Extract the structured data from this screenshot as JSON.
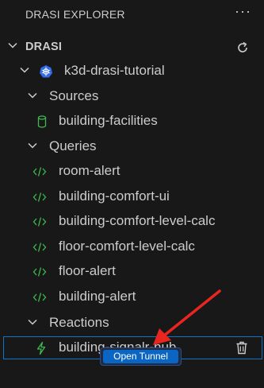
{
  "header": {
    "title": "DRASI EXPLORER",
    "more_icon": "ellipsis-icon"
  },
  "root": {
    "label": "DRASI",
    "refresh_icon": "refresh-icon"
  },
  "cluster": {
    "label": "k3d-drasi-tutorial",
    "icon": "kubernetes-icon"
  },
  "sources": {
    "label": "Sources",
    "items": [
      {
        "label": "building-facilities",
        "icon": "database-icon"
      }
    ]
  },
  "queries": {
    "label": "Queries",
    "items": [
      {
        "label": "room-alert"
      },
      {
        "label": "building-comfort-ui"
      },
      {
        "label": "building-comfort-level-calc"
      },
      {
        "label": "floor-comfort-level-calc"
      },
      {
        "label": "floor-alert"
      },
      {
        "label": "building-alert"
      }
    ]
  },
  "reactions": {
    "label": "Reactions",
    "items": [
      {
        "label": "building-signalr-hub",
        "icon": "bolt-icon",
        "action_icon": "trash-icon"
      }
    ]
  },
  "tooltip": {
    "label": "Open Tunnel"
  },
  "colors": {
    "accent": "#0a66c2",
    "selection": "#0e74c9",
    "arrow": "#e8261f",
    "green": "#3fb950"
  }
}
